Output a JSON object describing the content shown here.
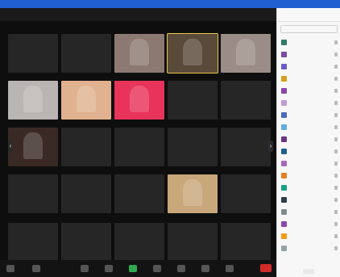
{
  "window": {
    "title_left": "",
    "title_right": ""
  },
  "tiles": [
    {
      "name": "",
      "row": 0,
      "col": 0,
      "video": false
    },
    {
      "name": "",
      "row": 0,
      "col": 1,
      "video": false
    },
    {
      "name": "",
      "row": 0,
      "col": 2,
      "video": true,
      "color": "#8c7a72"
    },
    {
      "name": "",
      "row": 0,
      "col": 3,
      "video": true,
      "color": "#5a4a3a",
      "active": true
    },
    {
      "name": "",
      "row": 0,
      "col": 4,
      "video": true,
      "color": "#9a8c86"
    },
    {
      "name": "",
      "row": 1,
      "col": 0,
      "video": true,
      "color": "#b9b5b2"
    },
    {
      "name": "",
      "row": 1,
      "col": 1,
      "video": true,
      "color": "#e0b28f"
    },
    {
      "name": "",
      "row": 1,
      "col": 2,
      "video": true,
      "color": "#e8335a"
    },
    {
      "name": "",
      "row": 1,
      "col": 3,
      "video": false
    },
    {
      "name": "",
      "row": 1,
      "col": 4,
      "video": false
    },
    {
      "name": "",
      "row": 2,
      "col": 0,
      "video": true,
      "color": "#3a2a25"
    },
    {
      "name": "",
      "row": 2,
      "col": 1,
      "video": false
    },
    {
      "name": "",
      "row": 2,
      "col": 2,
      "video": false
    },
    {
      "name": "",
      "row": 2,
      "col": 3,
      "video": false
    },
    {
      "name": "",
      "row": 2,
      "col": 4,
      "video": false
    },
    {
      "name": "",
      "row": 3,
      "col": 0,
      "video": false
    },
    {
      "name": "",
      "row": 3,
      "col": 1,
      "video": false
    },
    {
      "name": "",
      "row": 3,
      "col": 2,
      "video": false
    },
    {
      "name": "",
      "row": 3,
      "col": 3,
      "video": true,
      "color": "#c8a77a"
    },
    {
      "name": "",
      "row": 3,
      "col": 4,
      "video": false
    },
    {
      "name": "",
      "row": 4,
      "col": 0,
      "video": false
    },
    {
      "name": "",
      "row": 4,
      "col": 1,
      "video": false
    },
    {
      "name": "",
      "row": 4,
      "col": 2,
      "video": false
    },
    {
      "name": "",
      "row": 4,
      "col": 3,
      "video": false
    },
    {
      "name": "",
      "row": 4,
      "col": 4,
      "video": false
    }
  ],
  "toolbar": {
    "end_label": ""
  },
  "participants_panel": {
    "title": "",
    "search_placeholder": "",
    "avatar_colors": [
      "#2e7d6b",
      "#7b4aa3",
      "#6a5acd",
      "#d4a017",
      "#8e44ad",
      "#c39bd3",
      "#4a69bd",
      "#5dade2",
      "#6c3483",
      "#1f618d",
      "#a569bd",
      "#e67e22",
      "#16a085",
      "#2c3e50",
      "#7f8c8d",
      "#8e44ad",
      "#f39c12",
      "#95a5a6"
    ],
    "participants": [
      "",
      "",
      "",
      "",
      "",
      "",
      "",
      "",
      "",
      "",
      "",
      "",
      "",
      "",
      "",
      "",
      "",
      ""
    ]
  },
  "colors": {
    "accent": "#1f5fd1",
    "end": "#d22b2b",
    "tile": "#262626"
  }
}
